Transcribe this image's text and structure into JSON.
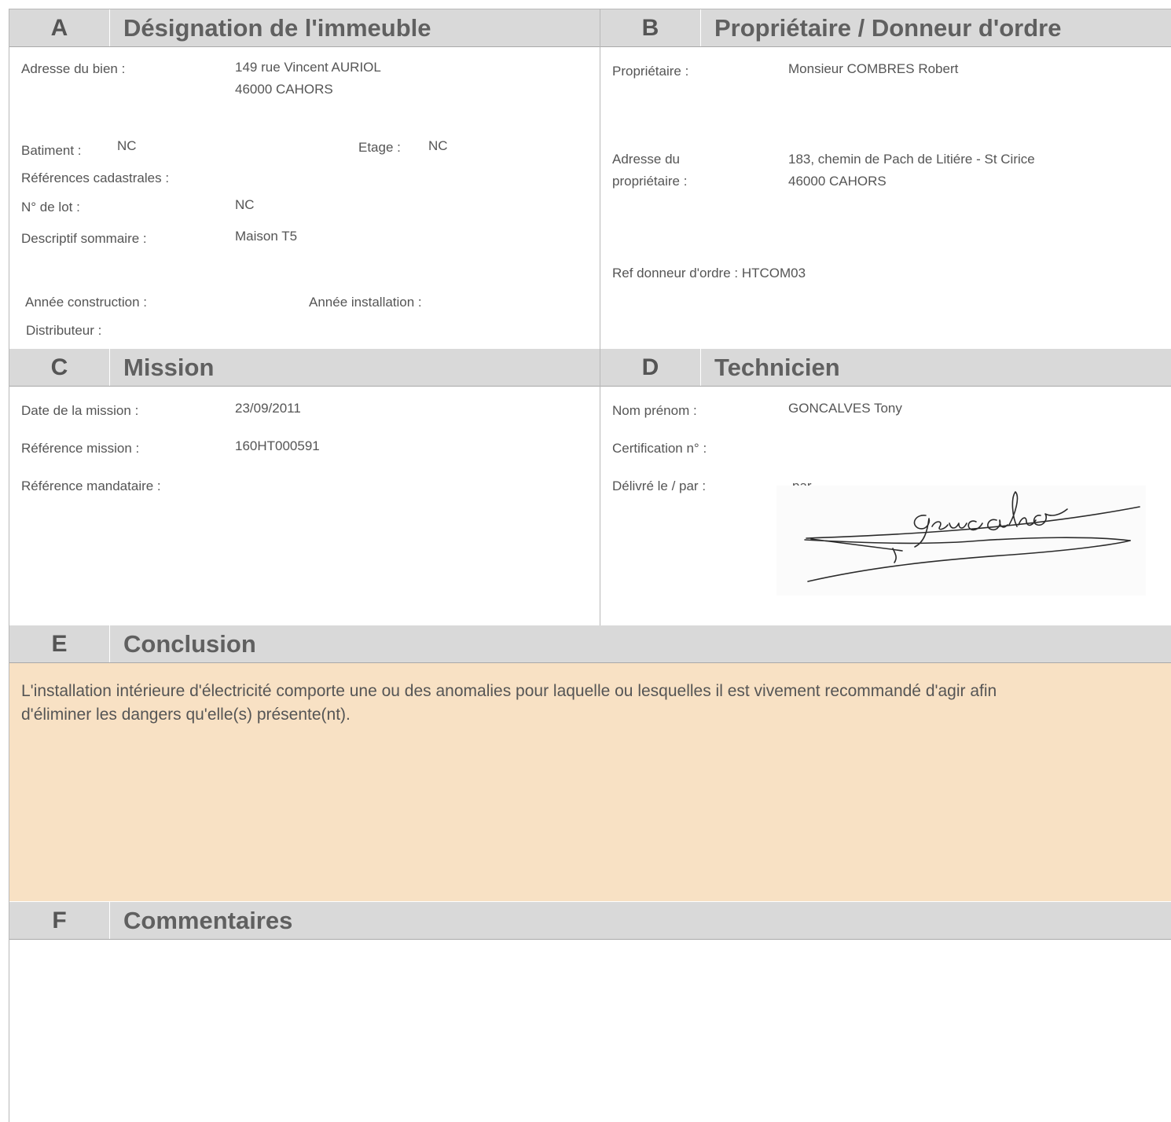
{
  "sections": {
    "a": {
      "letter": "A",
      "title": "Désignation de l'immeuble"
    },
    "b": {
      "letter": "B",
      "title": "Propriétaire / Donneur d'ordre"
    },
    "c": {
      "letter": "C",
      "title": "Mission"
    },
    "d": {
      "letter": "D",
      "title": "Technicien"
    },
    "e": {
      "letter": "E",
      "title": "Conclusion"
    },
    "f": {
      "letter": "F",
      "title": "Commentaires"
    }
  },
  "immeuble": {
    "adresse_label": "Adresse du bien :",
    "adresse_line1": "149 rue Vincent AURIOL",
    "adresse_line2": "46000 CAHORS",
    "batiment_label": "Batiment :",
    "batiment_value": "NC",
    "etage_label": "Etage :",
    "etage_value": "NC",
    "cadastre_label": "Références cadastrales :",
    "lot_label": "N° de lot :",
    "lot_value": "NC",
    "descriptif_label": "Descriptif sommaire :",
    "descriptif_value": "Maison T5",
    "annee_construction_label": "Année  construction :",
    "annee_installation_label": "Année  installation :",
    "distributeur_label": "Distributeur :"
  },
  "proprietaire": {
    "proprietaire_label": "Propriétaire :",
    "proprietaire_value": "Monsieur COMBRES Robert",
    "adresse_label_line1": "Adresse du",
    "adresse_label_line2": "propriétaire :",
    "adresse_line1": "183, chemin de Pach de Litiére - St Cirice",
    "adresse_line2": "46000 CAHORS",
    "ref_donneur": "Ref donneur d'ordre : HTCOM03"
  },
  "mission": {
    "date_label": "Date de la mission :",
    "date_value": "23/09/2011",
    "reference_label": "Référence mission :",
    "reference_value": "160HT000591",
    "mandataire_label": "Référence mandataire :"
  },
  "technicien": {
    "nom_label": "Nom prénom :",
    "nom_value": "GONCALVES Tony",
    "certification_label": "Certification n° :",
    "delivre_label": "Délivré le / par :",
    "delivre_value": "par",
    "signature_text": "Goncalves"
  },
  "conclusion": {
    "text": "L'installation intérieure d'électricité comporte une ou des anomalies pour laquelle ou lesquelles il est vivement recommandé d'agir afin d'éliminer les dangers qu'elle(s) présente(nt)."
  },
  "colors": {
    "header_bg": "#d9d9d9",
    "conclusion_bg": "#f8e1c4",
    "text": "#555555"
  }
}
